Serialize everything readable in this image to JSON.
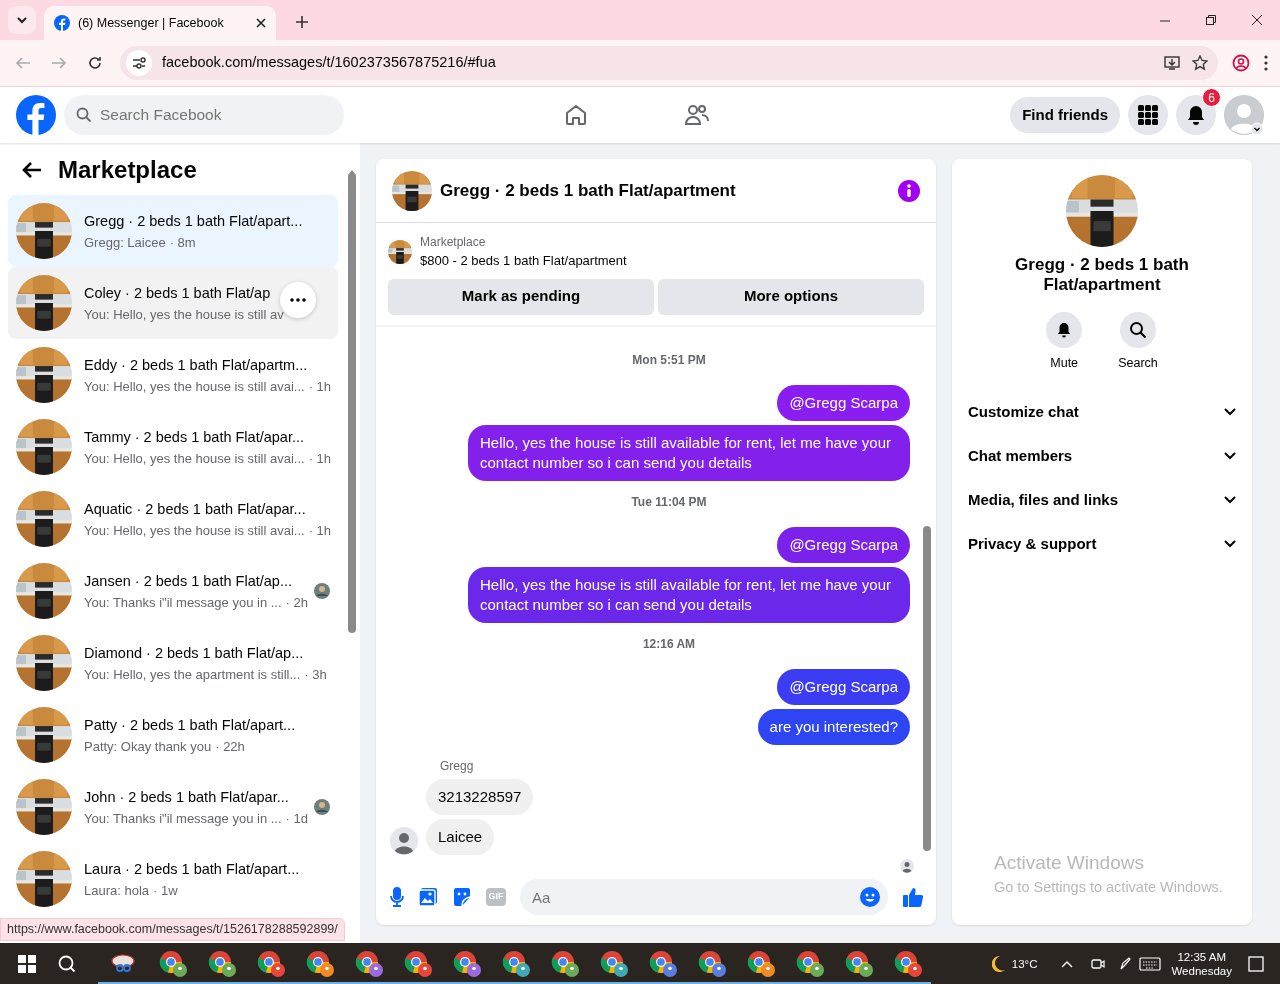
{
  "browser": {
    "tab_title": "(6) Messenger | Facebook",
    "url": "facebook.com/messages/t/1602373567875216/#fua",
    "status_url": "https://www.facebook.com/messages/t/1526178288592899/"
  },
  "topbar": {
    "search_placeholder": "Search Facebook",
    "find_friends": "Find friends",
    "notification_count": "6"
  },
  "sidebar": {
    "title": "Marketplace",
    "conversations": [
      {
        "title": "Gregg · 2 beds 1 bath Flat/apart...",
        "preview": "Gregg: Laicee",
        "time": "· 8m",
        "selected": true,
        "hovered": false,
        "seen": false
      },
      {
        "title": "Coley · 2 beds 1 bath Flat/ap",
        "preview": "You: Hello, yes the house is still av",
        "selected": false,
        "hovered": true,
        "seen": false
      },
      {
        "title": "Eddy · 2 beds 1 bath Flat/apartm...",
        "preview": "You: Hello, yes the house is still avai...",
        "time": "· 1h",
        "selected": false,
        "hovered": false,
        "seen": false
      },
      {
        "title": "Tammy · 2 beds 1 bath Flat/apar...",
        "preview": "You: Hello, yes the house is still avai...",
        "time": "· 1h",
        "selected": false,
        "hovered": false,
        "seen": false
      },
      {
        "title": "Aquatic · 2 beds 1 bath Flat/apar...",
        "preview": "You: Hello, yes the house is still avai...",
        "time": "· 1h",
        "selected": false,
        "hovered": false,
        "seen": false
      },
      {
        "title": "Jansen · 2 beds 1 bath Flat/ap...",
        "preview": "You: Thanks i\"il message you in ...",
        "time": "· 2h",
        "selected": false,
        "hovered": false,
        "seen": true
      },
      {
        "title": "Diamond · 2 beds 1 bath Flat/ap...",
        "preview": "You: Hello, yes the apartment is still...",
        "time": "· 3h",
        "selected": false,
        "hovered": false,
        "seen": false
      },
      {
        "title": "Patty · 2 beds 1 bath Flat/apart...",
        "preview": "Patty: Okay thank you",
        "time": "· 22h",
        "selected": false,
        "hovered": false,
        "seen": false
      },
      {
        "title": "John · 2 beds 1 bath Flat/apar...",
        "preview": "You: Thanks i\"il message you in ...",
        "time": "· 1d",
        "selected": false,
        "hovered": false,
        "seen": true
      },
      {
        "title": "Laura · 2 beds 1 bath Flat/apart...",
        "preview": "Laura: hola",
        "time": "· 1w",
        "selected": false,
        "hovered": false,
        "seen": false
      }
    ]
  },
  "chat": {
    "title": "Gregg · 2 beds 1 bath Flat/apartment",
    "listing_label": "Marketplace",
    "listing": "$800 - 2 beds 1 bath Flat/apartment",
    "buttons": [
      "Mark as pending",
      "More options"
    ],
    "messages": [
      {
        "kind": "timestamp",
        "text": "Mon 5:51 PM"
      },
      {
        "kind": "outgoing",
        "text": "@Gregg Scarpa",
        "color": "#8a1ef0"
      },
      {
        "kind": "outgoing",
        "text": "Hello, yes the house is still available for rent, let me have your contact number so i can send you details",
        "color": "#8420ec"
      },
      {
        "kind": "timestamp",
        "text": "Tue 11:04 PM"
      },
      {
        "kind": "outgoing",
        "text": "@Gregg Scarpa",
        "color": "#7a22ea"
      },
      {
        "kind": "outgoing",
        "text": "Hello, yes the house is still available for rent, let me have your contact number so i can send you details",
        "color": "#6b27ea"
      },
      {
        "kind": "timestamp",
        "text": "12:16 AM"
      },
      {
        "kind": "outgoing",
        "text": "@Gregg Scarpa",
        "color": "#3c3cf2"
      },
      {
        "kind": "outgoing",
        "text": "are you interested?",
        "color": "#2e45f4"
      },
      {
        "kind": "sender",
        "text": "Gregg"
      },
      {
        "kind": "incoming",
        "text": "3213228597",
        "avatar": false
      },
      {
        "kind": "incoming",
        "text": "Laicee",
        "avatar": true
      }
    ],
    "composer": {
      "placeholder": "Aa",
      "gif_label": "GIF"
    }
  },
  "details": {
    "title": "Gregg · 2 beds 1 bath Flat/apartment",
    "actions": [
      {
        "kind": "bell",
        "label": "Mute"
      },
      {
        "kind": "search",
        "label": "Search"
      }
    ],
    "sections": [
      "Customize chat",
      "Chat members",
      "Media, files and links",
      "Privacy & support"
    ]
  },
  "activation": {
    "title": "Activate Windows",
    "subtitle": "Go to Settings to activate Windows."
  },
  "taskbar": {
    "apps": [
      {
        "kind": "snipping"
      },
      {
        "kind": "chrome",
        "color": "#6aaa5a"
      },
      {
        "kind": "chrome",
        "color": "#6aaa5a"
      },
      {
        "kind": "chrome",
        "color": "#e8453c"
      },
      {
        "kind": "chrome",
        "color": "#f08a24"
      },
      {
        "kind": "chrome",
        "color": "#9c6ade"
      },
      {
        "kind": "chrome",
        "color": "#e8453c"
      },
      {
        "kind": "chrome",
        "color": "#9c6ade"
      },
      {
        "kind": "chrome",
        "color": "#3fa9b5"
      },
      {
        "kind": "chrome",
        "color": "#6aaa5a"
      },
      {
        "kind": "chrome",
        "color": "#3fa9b5"
      },
      {
        "kind": "chrome",
        "color": "#5a7de0"
      },
      {
        "kind": "chrome",
        "color": "#5a7de0"
      },
      {
        "kind": "chrome",
        "color": "#f08a24"
      },
      {
        "kind": "chrome",
        "color": "#6aaa5a"
      },
      {
        "kind": "chrome",
        "color": "#6aaa5a"
      },
      {
        "kind": "chrome",
        "color": "#e8453c"
      }
    ],
    "weather": "13°C",
    "time": "12:35 AM",
    "day": "Wednesday"
  }
}
